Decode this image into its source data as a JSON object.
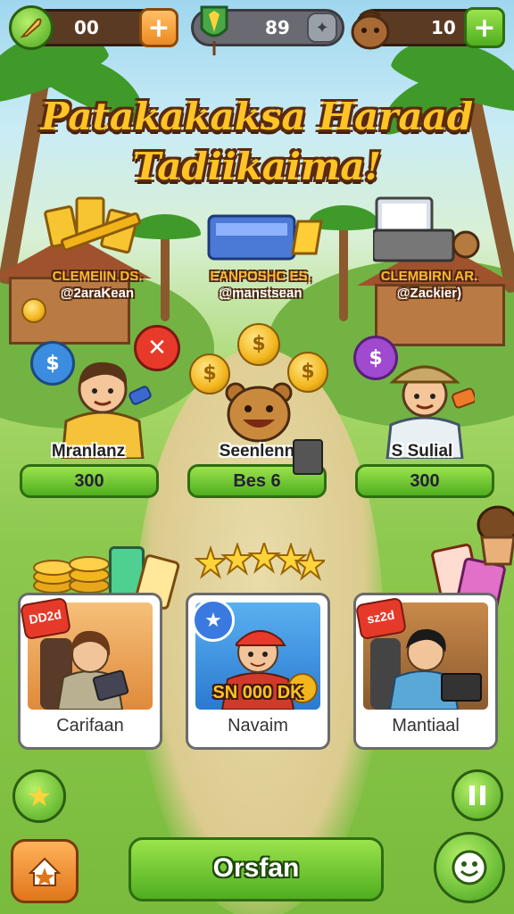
{
  "hud": {
    "left_value": "00",
    "center_value": "89",
    "right_value": "10"
  },
  "title": {
    "line1": "Patakakaksa Haraad",
    "line2": "Tadiikaima!"
  },
  "rewards": [
    {
      "label_line1": "CLEMEIIN DS.",
      "label_line2": "@2araKean"
    },
    {
      "label_line1": "EANPOSHC ES,",
      "label_line2": "@manstsean"
    },
    {
      "label_line1": "CLEMBIRN AR.",
      "label_line2": "@Zackier)"
    }
  ],
  "characters": [
    {
      "name": "Mranlanz",
      "button_value": "300"
    },
    {
      "name": "Seenlenn",
      "button_value": "Bes 6"
    },
    {
      "name": "S Sulial",
      "button_value": "300"
    }
  ],
  "cards": [
    {
      "badge": "DD2d",
      "title": "Carifaan"
    },
    {
      "badge": "",
      "title": "Navaim",
      "overlay": "SN 000 DK"
    },
    {
      "badge": "sz2d",
      "title": "Mantiaal"
    }
  ],
  "footer": {
    "main_button": "Orsfan"
  },
  "icons": {
    "hud_left": "feather-icon",
    "hud_center": "shield-flag-icon",
    "hud_right": "bag-icon",
    "bottom_left_top": "star-icon",
    "bottom_left": "home-star-icon",
    "bottom_right_top": "pause-icon",
    "bottom_right": "smiley-icon"
  },
  "colors": {
    "accent_green": "#5bbf24",
    "accent_orange": "#f0902a",
    "title_yellow": "#ffc425"
  }
}
